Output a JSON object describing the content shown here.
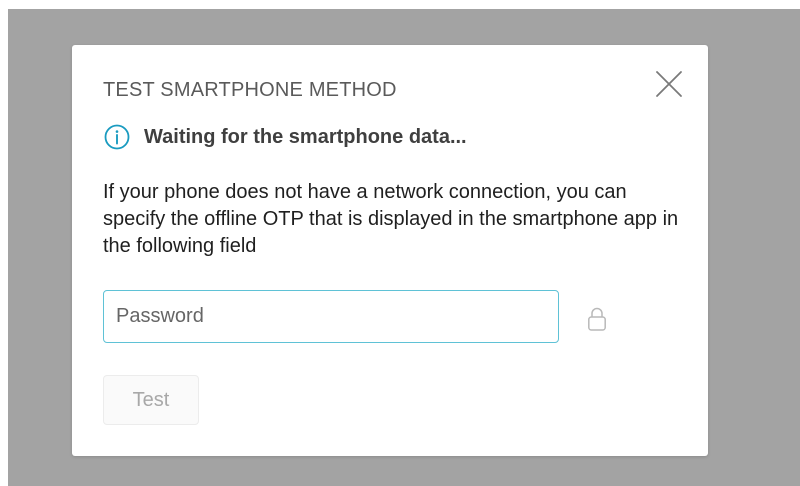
{
  "dialog": {
    "title": "TEST SMARTPHONE METHOD",
    "close_icon": "close-icon",
    "status": {
      "icon": "info-icon",
      "text": "Waiting for the smartphone data..."
    },
    "description": "If your phone does not have a network connection, you can specify the offline OTP that is displayed in the smartphone app in the following field",
    "password_field": {
      "placeholder": "Password",
      "value": "",
      "icon": "lock-icon"
    },
    "test_button": {
      "label": "Test",
      "enabled": false
    }
  },
  "colors": {
    "overlay": "#a3a3a3",
    "accent": "#1a9bc0",
    "input_border": "#5fc2d6",
    "disabled_text": "#a8a8a8"
  }
}
